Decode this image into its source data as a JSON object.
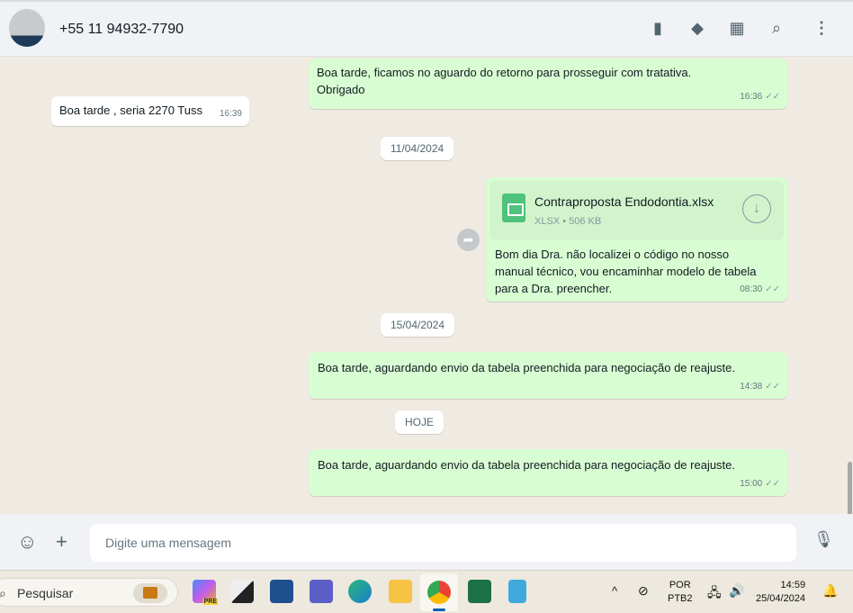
{
  "header": {
    "contact": "+55 11 94932-7790",
    "icons": [
      "archive-icon",
      "label-icon",
      "catalog-icon",
      "search-icon",
      "menu-icon"
    ]
  },
  "messages": [
    {
      "dir": "out",
      "text": "Boa tarde, ficamos no aguardo do retorno para prosseguir com tratativa.",
      "text2": "Obrigado",
      "time": "16:36"
    },
    {
      "dir": "in",
      "text": "Boa tarde ,  seria 2270 Tuss",
      "time": "16:39"
    },
    {
      "date": "11/04/2024"
    },
    {
      "dir": "out",
      "file": {
        "name": "Contraproposta Endodontia.xlsx",
        "type": "XLSX",
        "size": "506 KB"
      },
      "text": "Bom dia Dra. não localizei o código no nosso manual técnico, vou encaminhar modelo de tabela para a Dra. preencher.",
      "time": "08:30"
    },
    {
      "date": "15/04/2024"
    },
    {
      "dir": "out",
      "text": "Boa tarde, aguardando envio da tabela preenchida para negociação de reajuste.",
      "time": "14:38"
    },
    {
      "date": "HOJE"
    },
    {
      "dir": "out",
      "text": "Boa tarde, aguardando envio da tabela preenchida para negociação de reajuste.",
      "time": "15:00"
    }
  ],
  "composer": {
    "placeholder": "Digite uma mensagem"
  },
  "taskbar": {
    "search": "Pesquisar",
    "lang1": "POR",
    "lang2": "PTB2",
    "time": "14:59",
    "date": "25/04/2024",
    "copilot_badge": "PRE"
  },
  "colors": {
    "outgoing": "#d9fdd3",
    "background": "#efeae2"
  }
}
